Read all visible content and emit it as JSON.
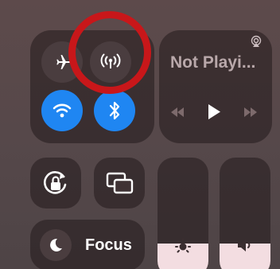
{
  "now_playing": {
    "title": "Not Playi..."
  },
  "focus": {
    "label": "Focus"
  },
  "connectivity": {
    "airplane_mode": false,
    "cellular": false,
    "wifi": true,
    "bluetooth": true
  },
  "sliders": {
    "brightness_level": 0.28,
    "volume_level": 0.28
  },
  "colors": {
    "accent_blue": "#1f86f2",
    "annotation_red": "#c8171a",
    "slider_fill": "#f3dde1"
  },
  "icons": [
    "airplane-icon",
    "cellular-icon",
    "wifi-icon",
    "bluetooth-icon",
    "airplay-icon",
    "rewind-icon",
    "play-icon",
    "fast-forward-icon",
    "rotation-lock-icon",
    "screen-mirroring-icon",
    "moon-icon",
    "brightness-icon",
    "speaker-icon"
  ]
}
